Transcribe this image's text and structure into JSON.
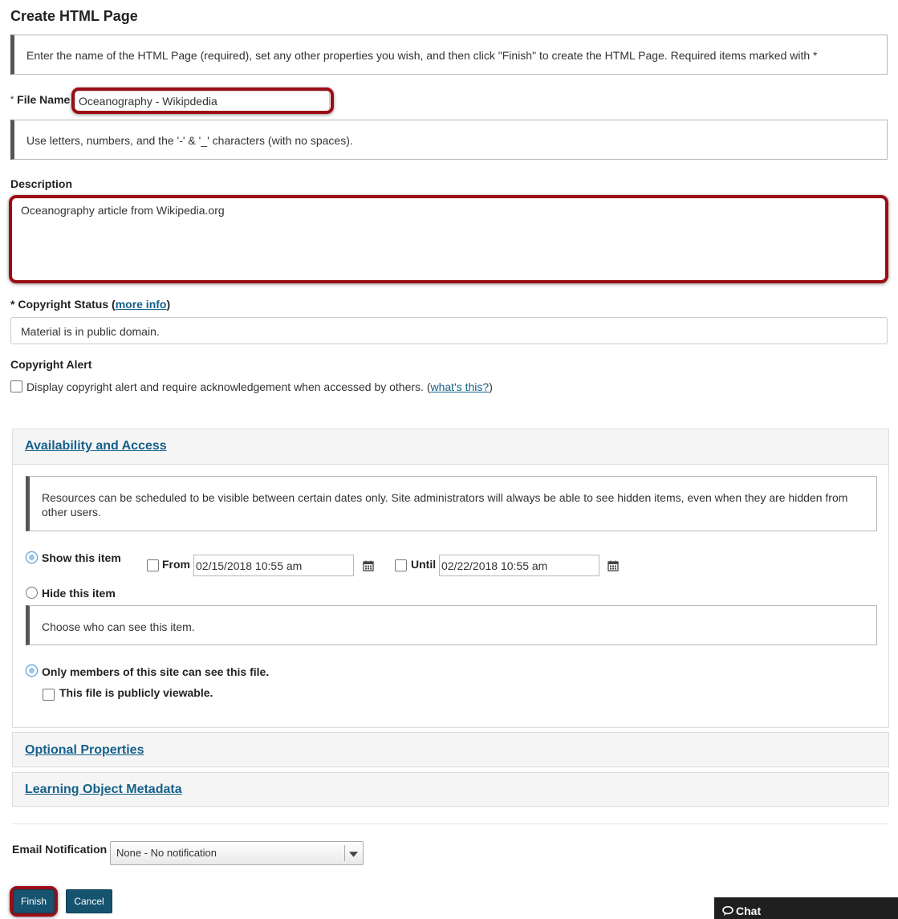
{
  "page": {
    "title": "Create HTML Page",
    "instructions": "Enter the name of the HTML Page (required), set any other properties you wish, and then click \"Finish\" to create the HTML Page. Required items marked with *"
  },
  "file_name": {
    "required_mark": "*",
    "label": "File Name",
    "value": "Oceanography - Wikipdedia",
    "hint": "Use letters, numbers, and the '-' & '_' characters (with no spaces)."
  },
  "description": {
    "label": "Description",
    "value": "Oceanography article from Wikipedia.org"
  },
  "copyright_status": {
    "required_mark": "*",
    "label": "Copyright Status",
    "open_paren": "(",
    "link": "more info",
    "close_paren": ")",
    "value": "Material is in public domain."
  },
  "copyright_alert": {
    "label": "Copyright Alert",
    "checkbox_text": "Display copyright alert and require acknowledgement when accessed by others.",
    "open_paren": "(",
    "link": "what's this?",
    "close_paren": ")",
    "checked": false
  },
  "availability": {
    "title": "Availability and Access",
    "info": "Resources can be scheduled to be visible between certain dates only. Site administrators will always be able to see hidden items, even when they are hidden from other users.",
    "show_label": "Show this item",
    "hide_label": "Hide this item",
    "selected": "show",
    "from_label": "From",
    "from_value": "02/15/2018 10:55 am",
    "until_label": "Until",
    "until_value": "02/22/2018 10:55 am",
    "who_info": "Choose who can see this item.",
    "members_label": "Only members of this site can see this file.",
    "public_label": "This file is publicly viewable."
  },
  "sections": {
    "optional": "Optional Properties",
    "metadata": "Learning Object Metadata"
  },
  "email": {
    "label": "Email Notification",
    "selected": "None - No notification"
  },
  "buttons": {
    "finish": "Finish",
    "cancel": "Cancel"
  },
  "chat": {
    "label": "Chat"
  },
  "colors": {
    "link": "#15608a",
    "highlight": "#9b0d16",
    "button": "#15536f"
  }
}
